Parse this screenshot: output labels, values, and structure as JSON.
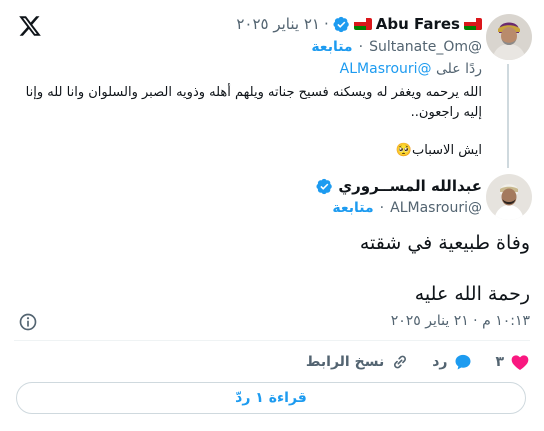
{
  "parent_tweet": {
    "display_name": "Abu Fares",
    "handle": "@Sultanate_Om",
    "date": "٢١ يناير ٢٠٢٥",
    "follow_label": "متابعة",
    "replying_prefix": "ردًا على",
    "replying_handle": "@ALMasrouri",
    "text": "الله يرحمه ويغفر له ويسكنه فسيح جناته ويلهم أهله وذويه الصبر والسلوان وانا لله وإنا إليه راجعون..",
    "text2": "ايش الاسباب",
    "emoji": "🥺"
  },
  "main_tweet": {
    "display_name": "عبدالله المســروري",
    "handle": "@ALMasrouri",
    "follow_label": "متابعة",
    "line1": "وفاة طبيعية في شقته",
    "line2": "رحمة الله عليه",
    "timestamp": "١٠:١٣ م · ٢١ يناير ٢٠٢٥"
  },
  "actions": {
    "like_count": "٣",
    "reply_label": "رد",
    "copy_link_label": "نسخ الرابط"
  },
  "read_replies_label": "قراءة ١ ردّ",
  "colors": {
    "accent": "#1d9bf0",
    "like": "#f91880",
    "muted": "#536471",
    "text": "#0f1419"
  }
}
